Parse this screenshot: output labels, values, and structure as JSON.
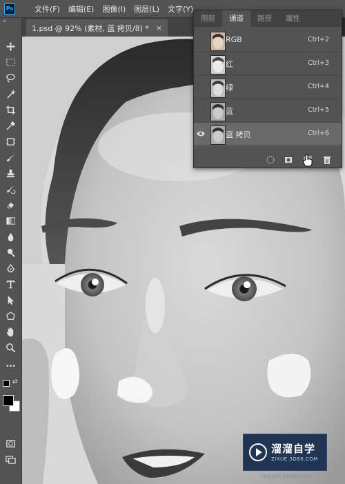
{
  "app": {
    "logo_text": "Ps"
  },
  "menu": [
    "文件(F)",
    "编辑(E)",
    "图像(I)",
    "图层(L)",
    "文字(Y)"
  ],
  "toolbar": {
    "grip": "»",
    "tools": [
      "move-icon",
      "marquee-icon",
      "lasso-icon",
      "magic-wand-icon",
      "crop-icon",
      "eyedropper-icon",
      "frame-icon",
      "brush-icon",
      "stamp-icon",
      "history-brush-icon",
      "eraser-icon",
      "gradient-icon",
      "blur-icon",
      "dodge-icon",
      "pen-icon",
      "type-icon",
      "path-select-icon",
      "shape-icon",
      "hand-icon",
      "zoom-icon",
      "more-icon"
    ],
    "foreground_color": "#000000",
    "background_color": "#ffffff"
  },
  "document": {
    "tab_title": "1.psd @ 92% (素材, 蓝 拷贝/8) *",
    "close_glyph": "×"
  },
  "panel": {
    "tabs": [
      "图层",
      "通道",
      "路径",
      "属性"
    ],
    "active_tab": 1,
    "channels": [
      {
        "name": "RGB",
        "shortcut": "Ctrl+2",
        "visible": false,
        "selected": false,
        "thumb": "color"
      },
      {
        "name": "红",
        "shortcut": "Ctrl+3",
        "visible": false,
        "selected": false,
        "thumb": "light"
      },
      {
        "name": "绿",
        "shortcut": "Ctrl+4",
        "visible": false,
        "selected": false,
        "thumb": "mid"
      },
      {
        "name": "蓝",
        "shortcut": "Ctrl+5",
        "visible": false,
        "selected": false,
        "thumb": "dark"
      },
      {
        "name": "蓝 拷贝",
        "shortcut": "Ctrl+6",
        "visible": true,
        "selected": true,
        "thumb": "dark"
      }
    ],
    "footer_icons": [
      "load-selection-icon",
      "save-selection-icon",
      "new-channel-icon",
      "delete-channel-icon"
    ]
  },
  "watermark": {
    "title": "溜溜自学",
    "subtitle": "ZIXUE.3D66.COM",
    "footer": "jingyan.baidu.com"
  },
  "colors": {
    "menubar": "#535353",
    "panel": "#535353",
    "selected_row": "#6a6a6a",
    "watermark_bg": "#1f3553"
  }
}
